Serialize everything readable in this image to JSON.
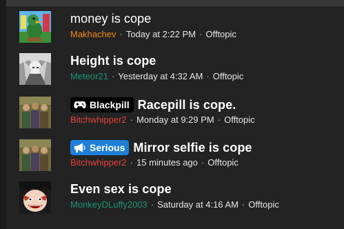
{
  "threads": [
    {
      "title": "money is cope",
      "prefix": null,
      "author": "Makhachev",
      "author_color": "#f08b1c",
      "time": "Today at 2:22 PM",
      "forum": "Offtopic",
      "avatar": "duck-cartoon-avatar"
    },
    {
      "title": "Height is cope",
      "prefix": null,
      "author": "Meteor21",
      "author_color": "#199473",
      "time": "Yesterday at 4:32 AM",
      "forum": "Offtopic",
      "avatar": "grayscale-figure-avatar"
    },
    {
      "title": "Racepill is cope.",
      "prefix": {
        "label": "Blackpill",
        "icon": "gamepad-icon",
        "color": "#000000"
      },
      "author": "Bitchwhipper2",
      "author_color": "#e5413a",
      "time": "Monday at 9:29 PM",
      "forum": "Offtopic",
      "avatar": "group-photo-avatar"
    },
    {
      "title": "Mirror selfie is cope",
      "prefix": {
        "label": "Serious",
        "icon": "megaphone-icon",
        "color": "#1f7fd8"
      },
      "author": "Bitchwhipper2",
      "author_color": "#e5413a",
      "time": "15 minutes ago",
      "forum": "Offtopic",
      "avatar": "group-photo-avatar"
    },
    {
      "title": "Even sex is cope",
      "prefix": null,
      "author": "MonkeyDLuffy2003",
      "author_color": "#199473",
      "time": "Saturday at 4:16 AM",
      "forum": "Offtopic",
      "avatar": "anime-character-avatar"
    }
  ],
  "separator": "·"
}
